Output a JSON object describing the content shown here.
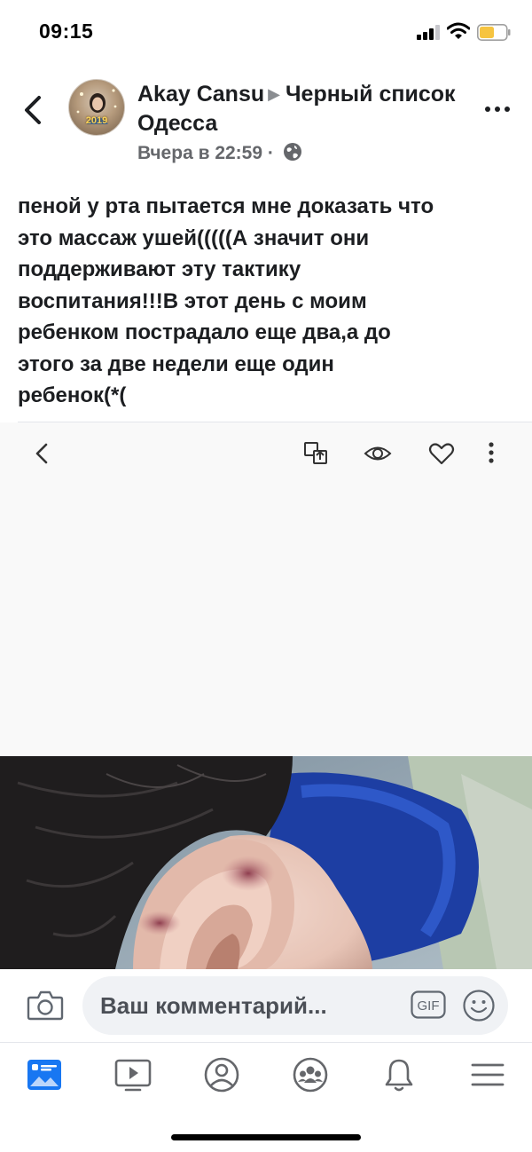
{
  "status_bar": {
    "time": "09:15"
  },
  "post_header": {
    "author": "Akay Cansu",
    "group": "Черный список Одесса",
    "timestamp": "Вчера в 22:59",
    "separator": "·",
    "avatar_badge": "2019"
  },
  "post": {
    "lines": [
      "пеной у рта пытается мне доказать что",
      "это массаж ушей(((((А значит они",
      "поддерживают эту тактику",
      "воспитания!!!В этот день с моим",
      "ребенком пострадало еще два,а до",
      "этого за две недели еще один",
      "ребенок(*("
    ]
  },
  "comment_bar": {
    "placeholder": "Ваш комментарий...",
    "gif_label": "GIF"
  },
  "icons": {
    "back": "chevron-left-icon",
    "more": "more-horizontal-icon",
    "viewer_back": "chevron-left-icon",
    "viewer_share": "share-icon",
    "viewer_views": "eye-icon",
    "viewer_like": "heart-icon",
    "viewer_more": "more-vertical-icon",
    "camera": "camera-icon",
    "emoji": "emoji-icon",
    "tabs": [
      "news-feed-icon",
      "watch-icon",
      "profile-icon",
      "groups-icon",
      "notifications-icon",
      "menu-icon"
    ]
  },
  "colors": {
    "accent": "#1877f2",
    "text": "#1c1e21",
    "secondary_text": "#65676b",
    "input_bg": "#f0f2f5",
    "battery": "#f6c441"
  }
}
